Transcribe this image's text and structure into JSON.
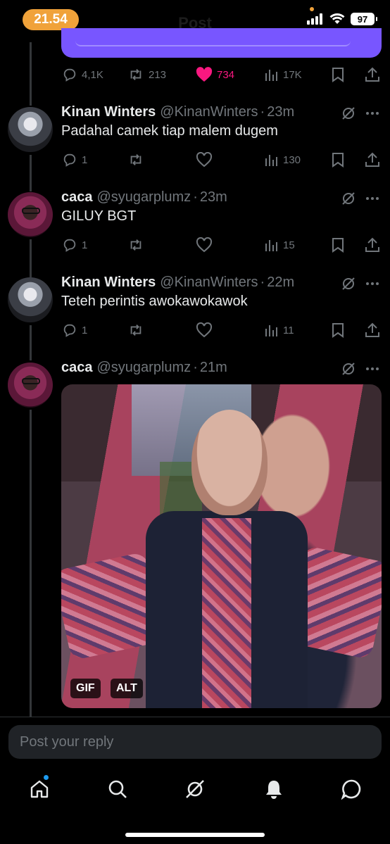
{
  "status_bar": {
    "time": "21.54",
    "faded_title": "Post",
    "battery": "97"
  },
  "top_post": {
    "replies": "4,1K",
    "reposts": "213",
    "likes": "734",
    "views": "17K"
  },
  "tweets": [
    {
      "name": "Kinan Winters",
      "handle": "@KinanWinters",
      "time": "23m",
      "text": "Padahal camek tiap malem dugem",
      "replies": "1",
      "views": "130"
    },
    {
      "name": "caca",
      "handle": "@syugarplumz",
      "time": "23m",
      "text": "GILUY BGT",
      "replies": "1",
      "views": "15"
    },
    {
      "name": "Kinan Winters",
      "handle": "@KinanWinters",
      "time": "22m",
      "text": "Teteh perintis awokawokawok",
      "replies": "1",
      "views": "11"
    },
    {
      "name": "caca",
      "handle": "@syugarplumz",
      "time": "21m",
      "media_badges": [
        "GIF",
        "ALT"
      ]
    }
  ],
  "separator": "·",
  "reply": {
    "placeholder": "Post your reply"
  },
  "nav": [
    "home-icon",
    "search-icon",
    "grok-icon",
    "notifications-icon",
    "messages-icon"
  ],
  "colors": {
    "like": "#f91880",
    "accent": "#1d9bf0",
    "card": "#7856ff",
    "status_pill": "#f0a23a"
  }
}
